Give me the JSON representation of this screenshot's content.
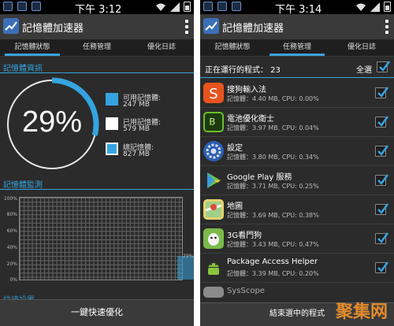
{
  "status_bar": {
    "time_left": "下午 3:12",
    "time_right": "下午 3:14"
  },
  "app": {
    "title": "記憶體加速器"
  },
  "tabs": [
    "記憶體狀態",
    "任務管理",
    "優化日誌"
  ],
  "memory": {
    "section_title": "記憶體資訊",
    "percent_text": "29%",
    "used_fraction": 0.29,
    "legend": [
      {
        "label": "可用記憶體:",
        "value": "247 MB",
        "color": "#35a4e0"
      },
      {
        "label": "已用記憶體:",
        "value": "579 MB",
        "color": "#ffffff"
      },
      {
        "label": "總記憶體:",
        "value": "827 MB",
        "color": "#35a4e0"
      }
    ]
  },
  "monitor": {
    "section_title": "記憶體監測",
    "y_labels": [
      "100%",
      "80%",
      "60%",
      "40%",
      "20%",
      "0%"
    ],
    "current_label": "29%",
    "current_value": 0.29
  },
  "quick_section": "快速設置",
  "quick_button": "一鍵快速優化",
  "tasks": {
    "running_label": "正在運行的程式： 23",
    "select_all": "全選",
    "items": [
      {
        "name": "搜狗輸入法",
        "meta": "記憶體：4.40 MB, CPU: 0.00%",
        "icon": "sogou-icon",
        "color": "#e8541e"
      },
      {
        "name": "電池優化衛士",
        "meta": "記憶體：3.97 MB, CPU: 0.04%",
        "icon": "battery-guard-icon",
        "color": "#6bbf2a"
      },
      {
        "name": "設定",
        "meta": "記憶體：3.80 MB, CPU: 0.34%",
        "icon": "settings-gear-icon",
        "color": "#2a5fb0"
      },
      {
        "name": "Google Play 服務",
        "meta": "記憶體：3.71 MB, CPU: 0.25%",
        "icon": "google-play-icon",
        "color": "#6ec24a"
      },
      {
        "name": "地圖",
        "meta": "記憶體：3.69 MB, CPU: 0.38%",
        "icon": "maps-icon",
        "color": "#e6d26a"
      },
      {
        "name": "3G看門狗",
        "meta": "記憶體：3.43 MB, CPU: 0.47%",
        "icon": "watchdog-icon",
        "color": "#7ab94a"
      },
      {
        "name": "Package Access Helper",
        "meta": "記憶體：3.39 MB, CPU: 0.20%",
        "icon": "android-icon",
        "color": "#8ac43f"
      },
      {
        "name": "SysScope",
        "meta": "",
        "icon": "sysscope-icon",
        "color": "#8a8a8a"
      }
    ],
    "bottom_button": "結束選中的程式"
  },
  "watermark": "聚集网"
}
